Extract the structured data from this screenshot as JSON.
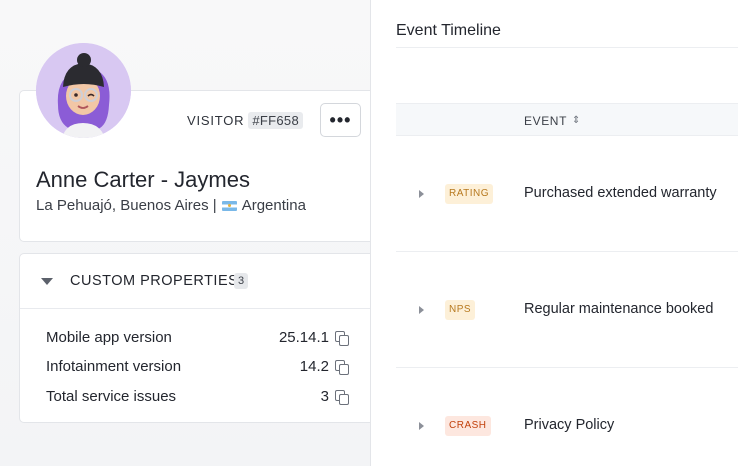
{
  "profile": {
    "visitor_label": "VISITOR",
    "visitor_id": "#FF658",
    "more_label": "•••",
    "name": "Anne Carter - Jaymes",
    "location_city": "La Pehuajó, Buenos Aires |",
    "location_country": "Argentina"
  },
  "custom_properties": {
    "title": "CUSTOM PROPERTIES",
    "count": "3",
    "items": [
      {
        "label": "Mobile app version",
        "value": "25.14.1"
      },
      {
        "label": "Infotainment version",
        "value": "14.2"
      },
      {
        "label": "Total service issues",
        "value": "3"
      }
    ]
  },
  "timeline": {
    "title": "Event Timeline",
    "column_event": "EVENT",
    "events": [
      {
        "tag": "RATING",
        "text": "Purchased extended warranty"
      },
      {
        "tag": "NPS",
        "text": "Regular maintenance booked"
      },
      {
        "tag": "CRASH",
        "text": "Privacy Policy"
      }
    ]
  },
  "colors": {
    "tag_warning_bg": "#fdf0d8",
    "tag_warning_fg": "#b7791f",
    "tag_crash_bg": "#fde7df",
    "tag_crash_fg": "#c2410c",
    "avatar_bg": "#d8c8f2"
  }
}
